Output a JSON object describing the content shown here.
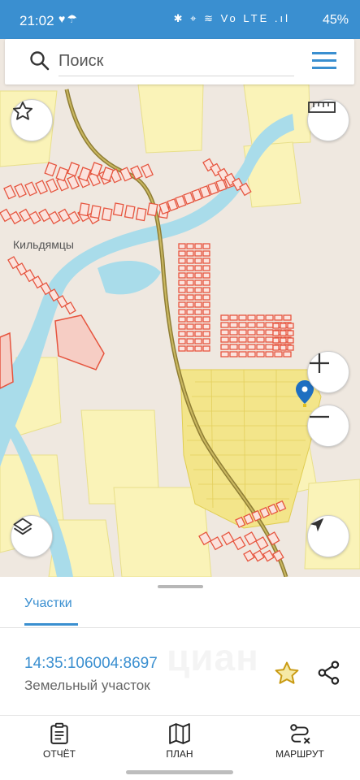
{
  "status_bar": {
    "time": "21:02",
    "left_icons": "♥☂",
    "right_icons": "✱ ⌖ ≋ Vo LTE .ıl",
    "battery": "45%"
  },
  "search": {
    "placeholder": "Поиск"
  },
  "map": {
    "place_label": "Кильдямцы"
  },
  "sheet": {
    "tab_label": "Участки",
    "parcel_number": "14:35:106004:8697",
    "parcel_type": "Земельный участок",
    "watermark": "циан"
  },
  "bottom_nav": {
    "report": "ОТЧЁТ",
    "plan": "ПЛАН",
    "route": "МАРШРУТ"
  },
  "colors": {
    "accent": "#3a8fd0",
    "river": "#a9dcea",
    "parcel_yellow": "#f5ec9a",
    "building_red": "#e6553f",
    "road": "#9c8a3c",
    "star": "#e4b916"
  }
}
